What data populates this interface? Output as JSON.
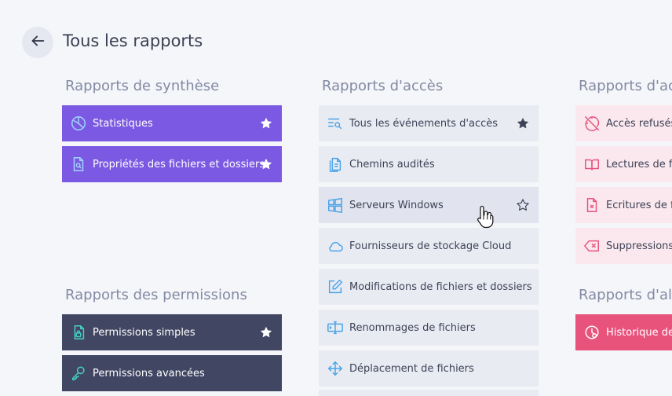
{
  "header": {
    "title": "Tous les rapports"
  },
  "sections": {
    "synthese": {
      "title": "Rapports de synthèse",
      "items": [
        {
          "label": "Statistiques",
          "icon": "pie-chart-icon",
          "starred": true
        },
        {
          "label": "Propriétés des fichiers et dossiers",
          "icon": "file-search-icon",
          "starred": true
        }
      ]
    },
    "permissions": {
      "title": "Rapports des permissions",
      "items": [
        {
          "label": "Permissions simples",
          "icon": "file-lock-icon",
          "starred": true
        },
        {
          "label": "Permissions avancées",
          "icon": "key-icon",
          "starred": false
        }
      ]
    },
    "acces": {
      "title": "Rapports d'accès",
      "items": [
        {
          "label": "Tous les événements d'accès",
          "icon": "list-search-icon",
          "starred": true
        },
        {
          "label": "Chemins audités",
          "icon": "documents-icon",
          "starred": false
        },
        {
          "label": "Serveurs Windows",
          "icon": "windows-icon",
          "starred": false
        },
        {
          "label": "Fournisseurs de stockage Cloud",
          "icon": "cloud-icon",
          "starred": false
        },
        {
          "label": "Modifications de fichiers et dossiers",
          "icon": "edit-icon",
          "starred": false
        },
        {
          "label": "Renommages de fichiers",
          "icon": "rename-icon",
          "starred": false
        },
        {
          "label": "Déplacement de fichiers",
          "icon": "move-icon",
          "starred": false
        }
      ]
    },
    "acces_refuses": {
      "title": "Rapports d'accè",
      "items": [
        {
          "label": "Accès refusés",
          "icon": "no-access-icon"
        },
        {
          "label": "Lectures de fich",
          "icon": "book-open-icon"
        },
        {
          "label": "Ecritures de fic",
          "icon": "file-x-icon"
        },
        {
          "label": "Suppressions",
          "icon": "delete-icon"
        }
      ]
    },
    "alertes": {
      "title": "Rapports d'ale",
      "items": [
        {
          "label": "Historique des",
          "icon": "history-icon"
        }
      ]
    }
  },
  "colors": {
    "purple": "#7b59e2",
    "dark": "#414763",
    "light": "#e9ebf3",
    "pink": "#fbe8ee",
    "pinkdark": "#e8537c",
    "accent_icon": "#4aa3e8",
    "red_icon": "#e8537c"
  }
}
